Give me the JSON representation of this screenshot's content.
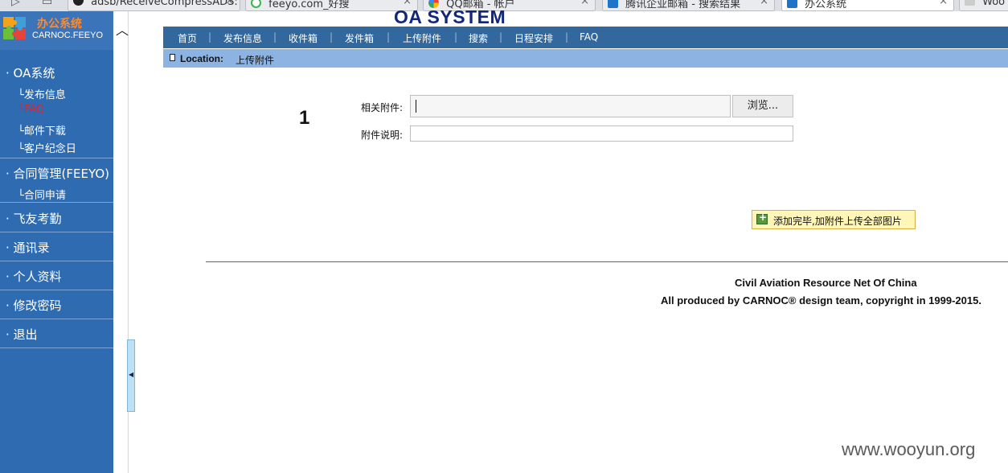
{
  "browser": {
    "tabs": [
      {
        "label": "adsb/ReceiveCompressADS:",
        "icon": "github-icon"
      },
      {
        "label": "feeyo.com_好搜",
        "icon": "search-engine-icon"
      },
      {
        "label": "QQ邮箱 - 帐户",
        "icon": "google-icon"
      },
      {
        "label": "腾讯企业邮箱 - 搜索结果",
        "icon": "mail-icon"
      },
      {
        "label": "办公系统",
        "icon": "checkbox-icon",
        "active": true
      },
      {
        "label": "Woo",
        "icon": "page-icon"
      }
    ],
    "close_glyph": "×"
  },
  "sidebar": {
    "logo_title": "办公系统",
    "logo_subtitle": "CARNOC.FEEYO",
    "groups": [
      {
        "label": "· OA系统",
        "items": [
          {
            "label": "└发布信息"
          },
          {
            "label": "└FAQ",
            "active": true
          },
          {
            "label": "└邮件下载"
          },
          {
            "label": "└客户纪念日"
          }
        ]
      },
      {
        "label": "· 合同管理(FEEYO)",
        "items": [
          {
            "label": "└合同申请"
          }
        ]
      },
      {
        "label": "· 飞友考勤",
        "items": []
      },
      {
        "label": "· 通讯录",
        "items": []
      },
      {
        "label": "· 个人资料",
        "items": []
      },
      {
        "label": "· 修改密码",
        "items": []
      },
      {
        "label": "· 退出",
        "items": []
      }
    ]
  },
  "header": {
    "system_title": "OA SYSTEM",
    "nav": [
      "首页",
      "发布信息",
      "收件箱",
      "发件箱",
      "上传附件",
      "搜索",
      "日程安排",
      "FAQ"
    ],
    "nav_separator": "|"
  },
  "location": {
    "label": "Location:",
    "value": "上传附件"
  },
  "form": {
    "row_number": "1",
    "attachment_label": "相关附件:",
    "attachment_value": "",
    "browse_label": "浏览...",
    "description_label": "附件说明:",
    "description_value": "",
    "add_button_label": "添加完毕,加附件上传全部图片"
  },
  "footer": {
    "line1": "Civil Aviation Resource Net Of China",
    "line2": "All produced by CARNOC® design team, copyright in 1999-2015."
  },
  "watermark": "www.wooyun.org",
  "colors": {
    "sidebar_bg": "#2f6bb0",
    "topnav_bg": "#33689e",
    "location_bg": "#8db3e2",
    "title_color": "#12277a",
    "active_sub_color": "#e0242a",
    "logo_title_color": "#ff8a2a"
  }
}
